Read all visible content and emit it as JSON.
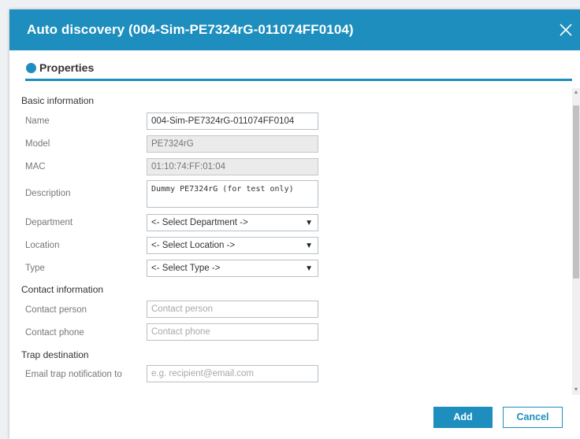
{
  "dialog": {
    "title": "Auto discovery (004-Sim-PE7324rG-011074FF0104)",
    "close_icon": "close-icon"
  },
  "tab": {
    "label": "Properties",
    "icon": "circle-dot-icon"
  },
  "sections": {
    "basic": "Basic information",
    "contact": "Contact information",
    "trap": "Trap destination"
  },
  "fields": {
    "name": {
      "label": "Name",
      "value": "004-Sim-PE7324rG-011074FF0104"
    },
    "model": {
      "label": "Model",
      "value": "PE7324rG"
    },
    "mac": {
      "label": "MAC",
      "value": "01:10:74:FF:01:04"
    },
    "description": {
      "label": "Description",
      "value": "Dummy PE7324rG (for test only)"
    },
    "department": {
      "label": "Department",
      "value": "<- Select Department ->"
    },
    "location": {
      "label": "Location",
      "value": "<- Select Location ->"
    },
    "type": {
      "label": "Type",
      "value": "<- Select Type ->"
    },
    "contact_person": {
      "label": "Contact person",
      "placeholder": "Contact person"
    },
    "contact_phone": {
      "label": "Contact phone",
      "placeholder": "Contact phone"
    },
    "email_trap": {
      "label": "Email trap notification to",
      "placeholder": "e.g. recipient@email.com"
    }
  },
  "buttons": {
    "add": "Add",
    "cancel": "Cancel"
  },
  "colors": {
    "accent": "#1d8ebd",
    "readonly_bg": "#ebebeb"
  }
}
